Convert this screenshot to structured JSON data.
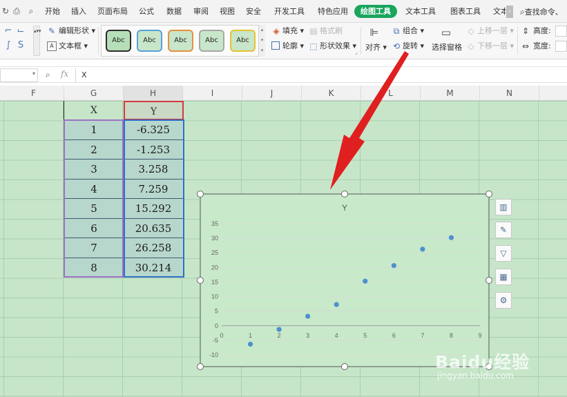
{
  "menubar": {
    "tabs": [
      "开始",
      "插入",
      "页面布局",
      "公式",
      "数据",
      "审阅",
      "视图",
      "安全",
      "开发工具",
      "特色应用"
    ],
    "active_tab": "绘图工具",
    "extra_tabs": [
      "文本工具",
      "图表工具",
      "文本"
    ],
    "search_label": "查找命令、"
  },
  "ribbon": {
    "edit_shape": "编辑形状",
    "text_box": "文本框",
    "shape_styles": [
      "Abc",
      "Abc",
      "Abc",
      "Abc",
      "Abc"
    ],
    "fill": "填充",
    "format_brush": "格式刷",
    "outline": "轮廓",
    "shape_effects": "形状效果",
    "align": "对齐",
    "group": "组合",
    "rotate": "旋转",
    "selection_pane": "选择窗格",
    "bring_forward": "上移一层",
    "send_backward": "下移一层",
    "height_label": "高度:",
    "width_label": "宽度:"
  },
  "formula_bar": {
    "fx": "fx",
    "value": "X"
  },
  "columns": [
    "F",
    "G",
    "H",
    "I",
    "J",
    "K",
    "L",
    "M",
    "N"
  ],
  "table": {
    "x_header": "X",
    "y_header": "Y",
    "x_values": [
      "1",
      "2",
      "3",
      "4",
      "5",
      "6",
      "7",
      "8"
    ],
    "y_values": [
      "-6.325",
      "-1.253",
      "3.258",
      "7.259",
      "15.292",
      "20.635",
      "26.258",
      "30.214"
    ]
  },
  "colors": {
    "accent_green": "#1aa55e",
    "sheet_bg": "#c7e6c9",
    "point_color": "#4f8fce",
    "selection_red": "#d03a3a",
    "selection_purple": "#9b71c4",
    "selection_blue": "#2f6fc7",
    "arrow_red": "#e02020"
  },
  "chart_data": {
    "type": "scatter",
    "title": "Y",
    "x": [
      1,
      2,
      3,
      4,
      5,
      6,
      7,
      8
    ],
    "y": [
      -6.325,
      -1.253,
      3.258,
      7.259,
      15.292,
      20.635,
      26.258,
      30.214
    ],
    "xlim": [
      0,
      9
    ],
    "ylim": [
      -10,
      35
    ],
    "x_ticks": [
      "0",
      "1",
      "2",
      "3",
      "4",
      "5",
      "6",
      "7",
      "8",
      "9"
    ],
    "y_ticks": [
      "-10",
      "-5",
      "0",
      "5",
      "10",
      "15",
      "20",
      "25",
      "30",
      "35"
    ],
    "grid": true,
    "legend": "none"
  },
  "chart_tools": [
    "chart-elements-icon",
    "chart-style-icon",
    "chart-filter-icon",
    "chart-layout-icon",
    "chart-settings-icon"
  ],
  "watermark": {
    "logo": "Baidu经验",
    "url": "jingyan.baidu.com"
  }
}
